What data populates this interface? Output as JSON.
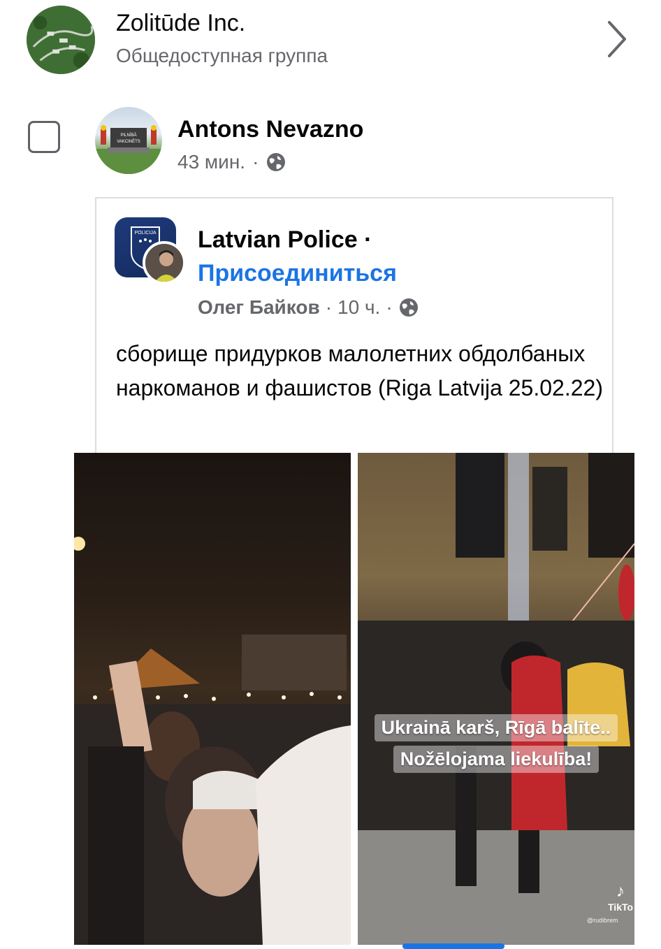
{
  "group": {
    "name": "Zolitūde Inc.",
    "subtitle": "Общедоступная группа",
    "avatar_icon": "aerial-neighborhood-photo"
  },
  "share": {
    "author_name": "Antons Nevazno",
    "time": "43 мин.",
    "separator": "·",
    "privacy_icon": "globe-icon",
    "avatar_sign_text": "PILNĪBĀ VAKCINĒTS"
  },
  "shared_post": {
    "page_name": "Latvian Police",
    "page_dot": "·",
    "join_label": "Присоединиться",
    "poster_name": "Олег Байков",
    "time": "10 ч.",
    "separator": "·",
    "page_avatar_text": "POLICIJA",
    "text": "сборище придурков малолетних обдолбаных наркоманов и фашистов (Riga Latvija 25.02.22)"
  },
  "media": {
    "caption_line1": "Ukrainā karš, Rīgā balīte..",
    "caption_line2": "Nožēlojama liekulība!",
    "watermark": "TikTo",
    "watermark_handle": "@rudibrem"
  },
  "colors": {
    "link_blue": "#1b74e4",
    "secondary_text": "#65676b",
    "primary_text": "#050505"
  }
}
